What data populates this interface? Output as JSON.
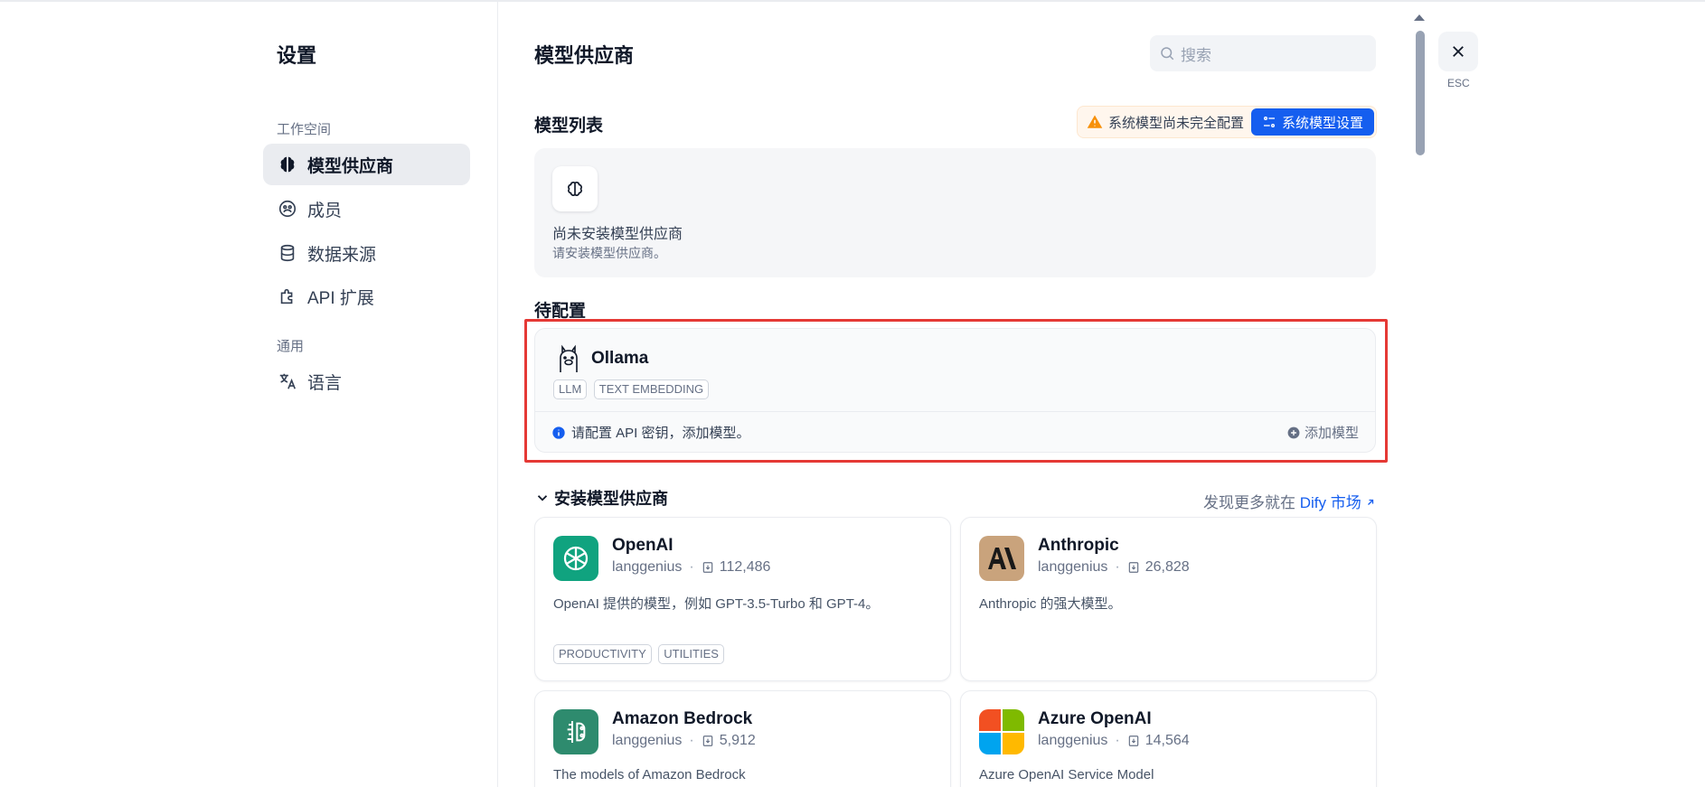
{
  "nav": {
    "title": "设置",
    "section_workspace": "工作空间",
    "section_general": "通用",
    "items": [
      {
        "label": "模型供应商",
        "icon": "brain-icon",
        "active": true
      },
      {
        "label": "成员",
        "icon": "members-icon",
        "active": false
      },
      {
        "label": "数据来源",
        "icon": "database-icon",
        "active": false
      },
      {
        "label": "API 扩展",
        "icon": "puzzle-icon",
        "active": false
      },
      {
        "label": "语言",
        "icon": "translate-icon",
        "active": false
      }
    ]
  },
  "main": {
    "title": "模型供应商",
    "search_placeholder": "搜索",
    "model_list_label": "模型列表",
    "warning_text": "系统模型尚未完全配置",
    "system_model_button": "系统模型设置",
    "empty": {
      "title": "尚未安装模型供应商",
      "subtitle": "请安装模型供应商。"
    },
    "pending_label": "待配置",
    "ollama": {
      "name": "Ollama",
      "tags": [
        "LLM",
        "TEXT EMBEDDING"
      ],
      "info": "请配置 API 密钥，添加模型。",
      "add_label": "添加模型"
    },
    "install_label": "安装模型供应商",
    "discover_prefix": "发现更多就在",
    "discover_link": "Dify 市场",
    "providers": [
      {
        "name": "OpenAI",
        "author": "langgenius",
        "installs": "112,486",
        "desc": "OpenAI 提供的模型，例如 GPT-3.5-Turbo 和 GPT-4。",
        "tags": [
          "PRODUCTIVITY",
          "UTILITIES"
        ]
      },
      {
        "name": "Anthropic",
        "author": "langgenius",
        "installs": "26,828",
        "desc": "Anthropic 的强大模型。",
        "tags": []
      },
      {
        "name": "Amazon Bedrock",
        "author": "langgenius",
        "installs": "5,912",
        "desc": "The models of Amazon Bedrock",
        "tags": []
      },
      {
        "name": "Azure OpenAI",
        "author": "langgenius",
        "installs": "14,564",
        "desc": "Azure OpenAI Service Model",
        "tags": []
      }
    ]
  },
  "esc_label": "ESC",
  "colors": {
    "accent": "#155eef",
    "highlight": "#e53935",
    "warning": "#f79009"
  }
}
